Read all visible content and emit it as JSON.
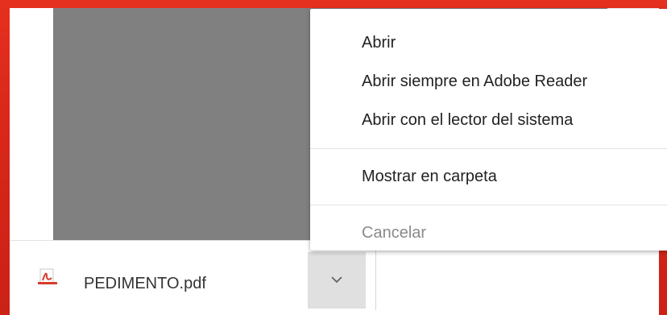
{
  "colors": {
    "frame": "#d9241b",
    "thumbnail": "#808080",
    "menu_bg": "#ffffff",
    "disabled_text": "#8a8a8a",
    "pdf_icon_red": "#d83b2f"
  },
  "context_menu": {
    "items": [
      {
        "label": "Abrir",
        "enabled": true
      },
      {
        "label": "Abrir siempre en Adobe Reader",
        "enabled": true
      },
      {
        "label": "Abrir con el lector del sistema",
        "enabled": true
      },
      {
        "label": "Mostrar en carpeta",
        "enabled": true
      },
      {
        "label": "Cancelar",
        "enabled": false
      }
    ]
  },
  "download_bar": {
    "file_name": "PEDIMENTO.pdf",
    "file_icon": "pdf-file-icon",
    "menu_toggle_icon": "chevron-down-icon"
  }
}
